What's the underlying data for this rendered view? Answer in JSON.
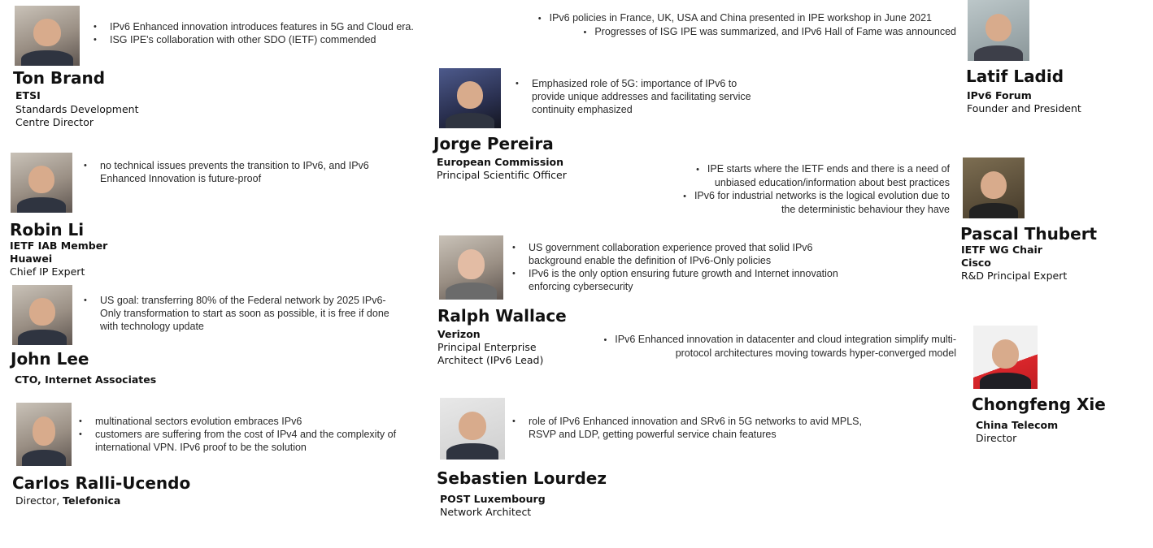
{
  "people": [
    {
      "key": "ton",
      "name": "Ton Brand",
      "org_lines": [
        "ETSI"
      ],
      "role_lines": [
        "Standards Development",
        "Centre Director"
      ],
      "bullets": [
        "IPv6 Enhanced innovation introduces features in 5G and Cloud era.",
        "ISG IPE's collaboration with other SDO (IETF) commended"
      ]
    },
    {
      "key": "robin",
      "name": "Robin Li",
      "org_lines": [
        "IETF IAB Member",
        "Huawei"
      ],
      "role_lines": [
        "Chief IP Expert"
      ],
      "bullets": [
        "no technical issues prevents the transition to IPv6, and IPv6 Enhanced Innovation is future-proof"
      ]
    },
    {
      "key": "john",
      "name": "John Lee",
      "org_lines": [
        "CTO, Internet Associates"
      ],
      "role_lines": [],
      "bullets": [
        "US goal: transferring 80% of the Federal network by 2025 IPv6-Only transformation to start as soon as possible, it is free if done with technology update"
      ]
    },
    {
      "key": "carlos",
      "name": "Carlos Ralli-Ucendo",
      "org_lines": [],
      "role_prefix": "Director, ",
      "role_bold": "Telefonica",
      "bullets": [
        "multinational sectors evolution embraces IPv6",
        "customers are suffering from the cost of IPv4 and the complexity of international VPN. IPv6 proof to be the solution"
      ]
    },
    {
      "key": "jorge",
      "name": "Jorge Pereira",
      "org_lines": [
        "European Commission"
      ],
      "role_lines": [
        "Principal Scientific Officer"
      ],
      "bullets": [
        "Emphasized role of 5G: importance of IPv6 to provide unique addresses and facilitating service continuity emphasized"
      ]
    },
    {
      "key": "ralph",
      "name": "Ralph Wallace",
      "org_lines": [
        "Verizon"
      ],
      "role_lines": [
        "Principal Enterprise",
        "Architect (IPv6 Lead)"
      ],
      "bullets": [
        "US government collaboration experience proved that solid IPv6 background enable the definition of IPv6-Only policies",
        "IPv6 is the only option ensuring future growth and Internet innovation enforcing cybersecurity"
      ]
    },
    {
      "key": "sebastien",
      "name": "Sebastien Lourdez",
      "org_lines": [
        "POST Luxembourg"
      ],
      "role_lines": [
        "Network Architect"
      ],
      "bullets": [
        "role of IPv6 Enhanced innovation and SRv6 in 5G networks to avid MPLS, RSVP and LDP, getting powerful service chain features"
      ]
    },
    {
      "key": "latif",
      "name": "Latif Ladid",
      "org_lines": [
        "IPv6 Forum"
      ],
      "role_lines": [
        "Founder and President"
      ],
      "bullets": [
        "IPv6 policies in France, UK, USA and China presented in IPE workshop in June 2021",
        "Progresses of ISG IPE was summarized, and IPv6 Hall of Fame was announced"
      ]
    },
    {
      "key": "pascal",
      "name": "Pascal Thubert",
      "org_lines": [
        "IETF WG Chair",
        "Cisco"
      ],
      "role_lines": [
        "R&D Principal Expert"
      ],
      "bullets": [
        "IPE starts where the IETF ends and there is a need of unbiased education/information about best practices",
        "IPv6 for industrial networks is the logical evolution due to the deterministic behaviour they have"
      ]
    },
    {
      "key": "chongfeng",
      "name": "Chongfeng Xie",
      "org_lines": [
        "China Telecom"
      ],
      "role_lines": [
        "Director"
      ],
      "bullets": [
        "IPv6 Enhanced innovation in datacenter and cloud integration simplify multi-protocol architectures moving towards hyper-converged model"
      ]
    }
  ]
}
